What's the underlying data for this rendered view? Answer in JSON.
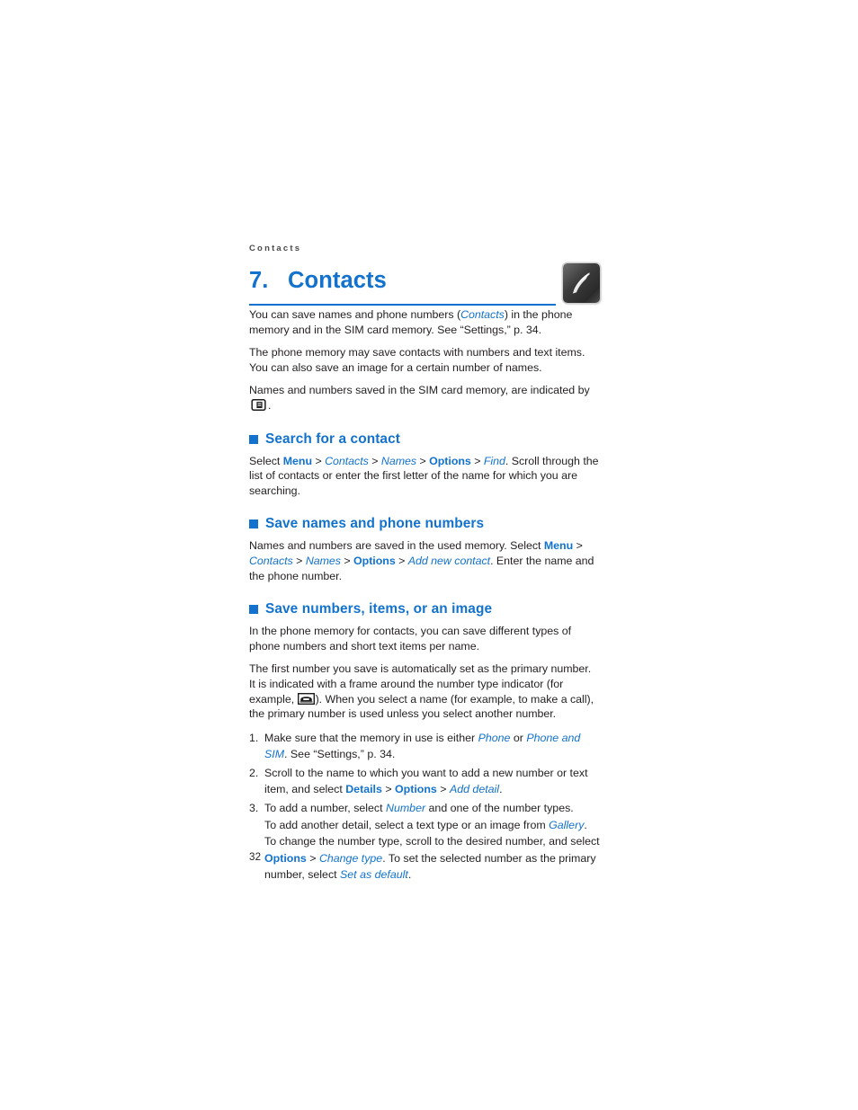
{
  "page": {
    "running_header": "Contacts",
    "folio": "32",
    "accent_color": "#1272cd",
    "text_color": "#231f20"
  },
  "chapter": {
    "number": "7.",
    "title": "Contacts",
    "icon": "phone-handset-icon"
  },
  "intro": {
    "p1": [
      {
        "t": "You can save names and phone numbers (",
        "s": "plain"
      },
      {
        "t": "Contacts",
        "s": "italic-blue"
      },
      {
        "t": ") in the phone memory and in the SIM card memory. See “Settings,” p. 34.",
        "s": "plain"
      }
    ],
    "p2": [
      {
        "t": "The phone memory may save contacts with numbers and text items. You can also save an image for a certain number of names.",
        "s": "plain"
      }
    ],
    "p3_before": "Names and numbers saved in the SIM card memory, are indicated by",
    "p3_icon": "sim-card-icon",
    "p3_after": "."
  },
  "sections": [
    {
      "id": "search-for-a-contact",
      "heading": "Search for a contact",
      "paragraph": [
        {
          "t": "Select ",
          "s": "plain"
        },
        {
          "t": "Menu",
          "s": "ui-blue"
        },
        {
          "t": " > ",
          "s": "plain"
        },
        {
          "t": "Contacts",
          "s": "italic-blue"
        },
        {
          "t": " > ",
          "s": "plain"
        },
        {
          "t": "Names",
          "s": "italic-blue"
        },
        {
          "t": " > ",
          "s": "plain"
        },
        {
          "t": "Options",
          "s": "ui-blue"
        },
        {
          "t": " > ",
          "s": "plain"
        },
        {
          "t": "Find",
          "s": "italic-blue"
        },
        {
          "t": ". Scroll through the list of contacts or enter the first letter of the name for which you are searching.",
          "s": "plain"
        }
      ]
    },
    {
      "id": "save-names-and-phone-numbers",
      "heading": "Save names and phone numbers",
      "paragraph": [
        {
          "t": "Names and numbers are saved in the used memory. Select ",
          "s": "plain"
        },
        {
          "t": "Menu",
          "s": "ui-blue"
        },
        {
          "t": " > ",
          "s": "plain"
        },
        {
          "t": "Contacts",
          "s": "italic-blue"
        },
        {
          "t": " > ",
          "s": "plain"
        },
        {
          "t": "Names",
          "s": "italic-blue"
        },
        {
          "t": " > ",
          "s": "plain"
        },
        {
          "t": "Options",
          "s": "ui-blue"
        },
        {
          "t": " > ",
          "s": "plain"
        },
        {
          "t": "Add new contact",
          "s": "italic-blue"
        },
        {
          "t": ". Enter the name and the phone number.",
          "s": "plain"
        }
      ]
    },
    {
      "id": "save-numbers-items-or-an-image",
      "heading": "Save numbers, items, or an image"
    }
  ],
  "save_numbers": {
    "p1": "In the phone memory for contacts, you can save different types of phone numbers and short text items per name.",
    "p2_before": "The first number you save is automatically set as the primary number. It is indicated with a frame around the number type indicator (for example,",
    "p2_icon": "phone-number-type-icon",
    "p2_after": "). When you select a name (for example, to make a call), the primary number is used unless you select another number.",
    "steps": [
      {
        "num": "1.",
        "runs": [
          {
            "t": "Make sure that the memory in use is either ",
            "s": "plain"
          },
          {
            "t": "Phone",
            "s": "italic-blue"
          },
          {
            "t": " or ",
            "s": "plain"
          },
          {
            "t": "Phone and SIM",
            "s": "italic-blue"
          },
          {
            "t": ". See “Settings,” p. 34.",
            "s": "plain"
          }
        ]
      },
      {
        "num": "2.",
        "runs": [
          {
            "t": "Scroll to the name to which you want to add a new number or text item, and select ",
            "s": "plain"
          },
          {
            "t": "Details",
            "s": "ui-blue"
          },
          {
            "t": " > ",
            "s": "plain"
          },
          {
            "t": "Options",
            "s": "ui-blue"
          },
          {
            "t": " > ",
            "s": "plain"
          },
          {
            "t": "Add detail",
            "s": "italic-blue"
          },
          {
            "t": ".",
            "s": "plain"
          }
        ]
      },
      {
        "num": "3.",
        "runs": [
          {
            "t": "To add a number, select ",
            "s": "plain"
          },
          {
            "t": "Number",
            "s": "italic-blue"
          },
          {
            "t": " and one of the number types.",
            "s": "plain"
          }
        ],
        "subparagraphs": [
          [
            {
              "t": "To add another detail, select a text type or an image from ",
              "s": "plain"
            },
            {
              "t": "Gallery",
              "s": "italic-blue"
            },
            {
              "t": ".",
              "s": "plain"
            }
          ],
          [
            {
              "t": "To change the number type, scroll to the desired number, and select ",
              "s": "plain"
            },
            {
              "t": "Options",
              "s": "ui-blue"
            },
            {
              "t": " > ",
              "s": "plain"
            },
            {
              "t": "Change type",
              "s": "italic-blue"
            },
            {
              "t": ". To set the selected number as the primary number, select ",
              "s": "plain"
            },
            {
              "t": "Set as default",
              "s": "italic-blue"
            },
            {
              "t": ".",
              "s": "plain"
            }
          ]
        ]
      }
    ]
  }
}
